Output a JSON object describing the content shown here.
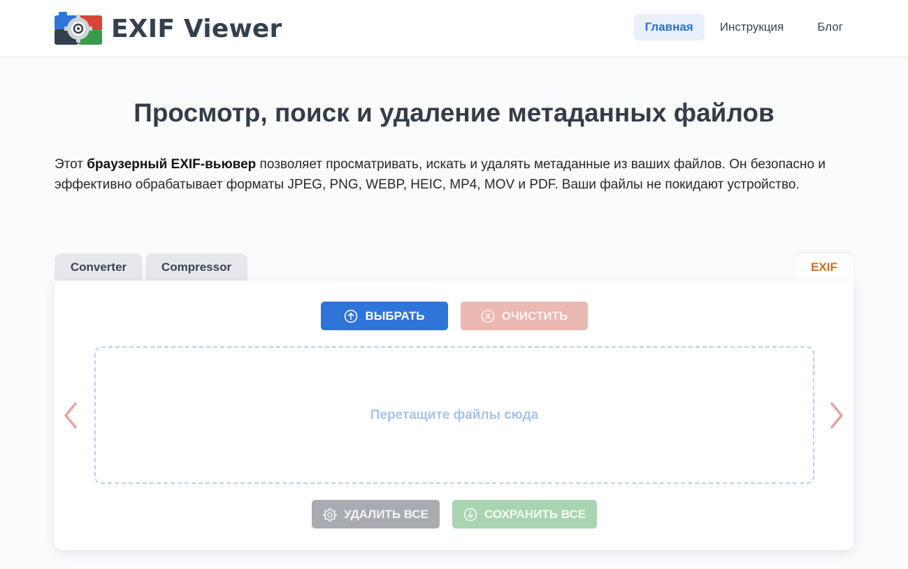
{
  "header": {
    "logo_text": "EXIF Viewer",
    "nav": [
      {
        "label": "Главная",
        "active": true
      },
      {
        "label": "Инструкция",
        "active": false
      },
      {
        "label": "Блог",
        "active": false
      }
    ]
  },
  "main": {
    "title": "Просмотр, поиск и удаление метаданных файлов",
    "description": {
      "prefix": "Этот ",
      "bold": "браузерный EXIF-вьювер",
      "suffix": " позволяет просматривать, искать и удалять метаданные из ваших файлов. Он безопасно и эффективно обрабатывает форматы JPEG, PNG, WEBP, HEIC, MP4, MOV и PDF. Ваши файлы не покидают устройство."
    }
  },
  "tabs": [
    {
      "label": "Converter",
      "active": false
    },
    {
      "label": "Compressor",
      "active": false
    },
    {
      "label": "EXIF",
      "active": true
    }
  ],
  "panel": {
    "select_label": "ВЫБРАТЬ",
    "clear_label": "ОЧИСТИТЬ",
    "drop_text": "Перетащите файлы сюда",
    "delete_all_label": "УДАЛИТЬ ВСЕ",
    "save_all_label": "СОХРАНИТЬ ВСЕ"
  },
  "icons": {
    "select": "upload-circle-icon",
    "clear": "close-circle-icon",
    "delete_all": "gear-icon",
    "save_all": "download-circle-icon",
    "prev": "chevron-left-icon",
    "next": "chevron-right-icon"
  },
  "colors": {
    "primary": "#2f74d8",
    "clear": "#ebb8b2",
    "delete": "#a8abaf",
    "save": "#a9d4b2",
    "accent_tab": "#d07020",
    "arrow": "#e4a49a"
  }
}
